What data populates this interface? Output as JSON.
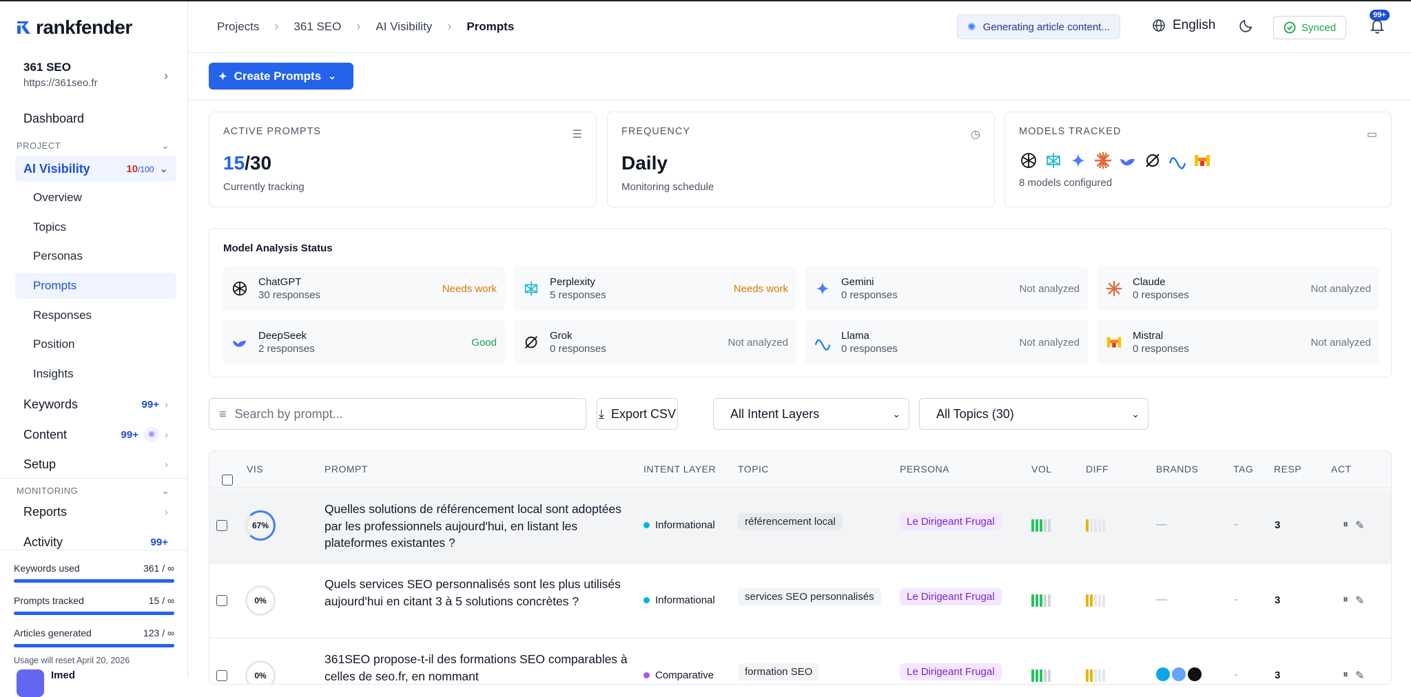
{
  "brand": {
    "name": "rankfender",
    "accent": "#2563eb"
  },
  "project": {
    "name": "361 SEO",
    "url": "https://361seo.fr"
  },
  "sidebar": {
    "dashboard": "Dashboard",
    "project_section": "PROJECT",
    "ai_visibility": {
      "label": "AI Visibility",
      "used": "10",
      "limit": "/100"
    },
    "sub_items": [
      "Overview",
      "Topics",
      "Personas",
      "Prompts",
      "Responses",
      "Position",
      "Insights"
    ],
    "keywords": {
      "label": "Keywords",
      "count": "99+"
    },
    "content": {
      "label": "Content",
      "count": "99+"
    },
    "setup": {
      "label": "Setup"
    },
    "monitoring_section": "MONITORING",
    "reports": {
      "label": "Reports"
    },
    "activity": {
      "label": "Activity",
      "count": "99+"
    }
  },
  "usage": {
    "keywords_label": "Keywords used",
    "keywords_value": "361 / ∞",
    "prompts_label": "Prompts tracked",
    "prompts_value": "15 / ∞",
    "articles_label": "Articles generated",
    "articles_value": "123 / ∞",
    "reset": "Usage will reset April 20, 2026"
  },
  "user": {
    "name": "Imed"
  },
  "header": {
    "breadcrumbs": [
      "Projects",
      "361 SEO",
      "AI Visibility",
      "Prompts"
    ],
    "generating": "Generating article content...",
    "language": "English",
    "synced": "Synced",
    "notifications": "99+"
  },
  "toolbar": {
    "create_label": "Create Prompts"
  },
  "cards": {
    "active": {
      "label": "ACTIVE PROMPTS",
      "value": "15",
      "total": "/30",
      "desc": "Currently tracking"
    },
    "frequency": {
      "label": "FREQUENCY",
      "value": "Daily",
      "desc": "Monitoring schedule"
    },
    "models": {
      "label": "MODELS TRACKED",
      "desc": "8 models configured"
    }
  },
  "status": {
    "title": "Model Analysis Status",
    "models": [
      {
        "name": "ChatGPT",
        "responses": "30 responses",
        "status": "Needs work",
        "kind": "needs"
      },
      {
        "name": "Perplexity",
        "responses": "5 responses",
        "status": "Needs work",
        "kind": "needs"
      },
      {
        "name": "Gemini",
        "responses": "0 responses",
        "status": "Not analyzed",
        "kind": "na"
      },
      {
        "name": "Claude",
        "responses": "0 responses",
        "status": "Not analyzed",
        "kind": "na"
      },
      {
        "name": "DeepSeek",
        "responses": "2 responses",
        "status": "Good",
        "kind": "good"
      },
      {
        "name": "Grok",
        "responses": "0 responses",
        "status": "Not analyzed",
        "kind": "na"
      },
      {
        "name": "Llama",
        "responses": "0 responses",
        "status": "Not analyzed",
        "kind": "na"
      },
      {
        "name": "Mistral",
        "responses": "0 responses",
        "status": "Not analyzed",
        "kind": "na"
      }
    ]
  },
  "filters": {
    "search_placeholder": "Search by prompt...",
    "export_label": "Export CSV",
    "intent_select": "All Intent Layers",
    "topic_select": "All Topics (30)"
  },
  "table": {
    "headers": [
      "VIS",
      "PROMPT",
      "INTENT LAYER",
      "TOPIC",
      "PERSONA",
      "VOL",
      "DIFF",
      "BRANDS",
      "TAG",
      "RESP",
      "ACT"
    ],
    "rows": [
      {
        "vis": "67%",
        "vis_pct": 67,
        "prompt": "Quelles solutions de référencement local sont adoptées par les professionnels aujourd'hui, en listant les plateformes existantes ?",
        "intent": "Informational",
        "intent_color": "#06b6d4",
        "topic": "référencement local",
        "persona": "Le Dirigeant Frugal",
        "brands": "—",
        "tag": "-",
        "resp": "3"
      },
      {
        "vis": "0%",
        "vis_pct": 0,
        "prompt": "Quels services SEO personnalisés sont les plus utilisés aujourd'hui en citant 3 à 5 solutions concrètes ?",
        "intent": "Informational",
        "intent_color": "#06b6d4",
        "topic": "services SEO personnalisés",
        "persona": "Le Dirigeant Frugal",
        "brands": "—",
        "tag": "-",
        "resp": "3"
      },
      {
        "vis": "0%",
        "vis_pct": 0,
        "prompt": "361SEO propose-t-il des formations SEO comparables à celles de seo.fr, en nommant",
        "intent": "Comparative",
        "intent_color": "#a855f7",
        "topic": "formation SEO",
        "persona": "Le Dirigeant Frugal",
        "brands": "",
        "tag": "-",
        "resp": "3"
      }
    ]
  }
}
